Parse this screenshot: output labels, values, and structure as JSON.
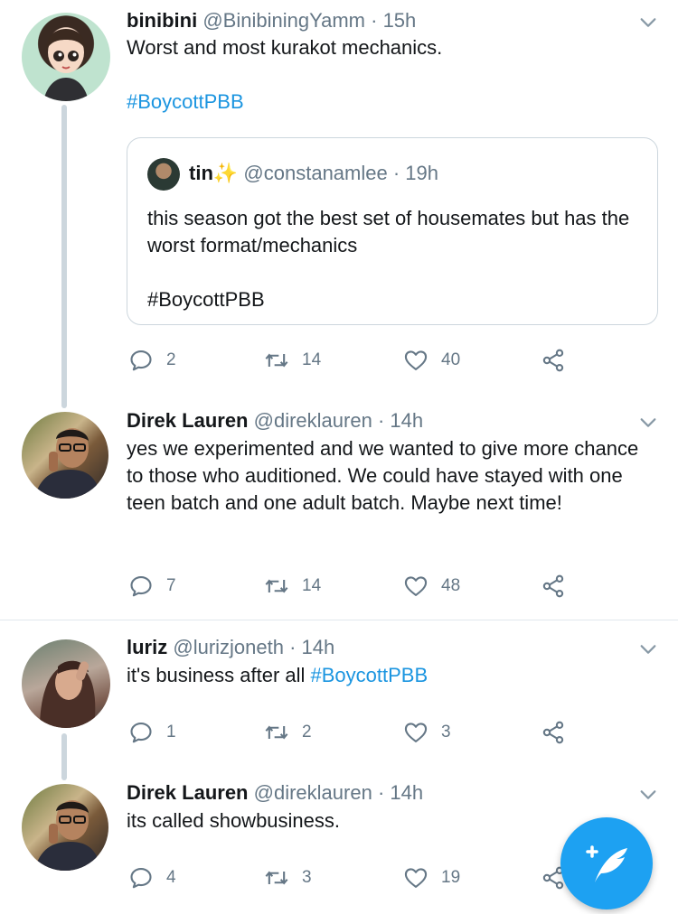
{
  "colors": {
    "accent": "#1da1f2",
    "hashtag": "#1b95e0",
    "muted": "#657786",
    "text": "#14171a"
  },
  "tweets": [
    {
      "author": "binibini",
      "handle": "@BinibiningYamm",
      "time": "· 15h",
      "text": "Worst and most kurakot mechanics.",
      "hashtag": "#BoycottPBB",
      "quote": {
        "author": "tin",
        "emoji": "✨",
        "handle": "@constanamlee",
        "time": "· 19h",
        "text": "this season got the best set of housemates but has the worst format/mechanics",
        "hashtag": "#BoycottPBB"
      },
      "replies": "2",
      "retweets": "14",
      "likes": "40"
    },
    {
      "author": "Direk Lauren",
      "handle": "@direklauren",
      "time": "· 14h",
      "text": "yes we experimented and we wanted to give more chance to those who auditioned. We could have stayed with one teen batch and one adult batch.  Maybe next time!",
      "replies": "7",
      "retweets": "14",
      "likes": "48"
    },
    {
      "author": "luriz",
      "handle": "@lurizjoneth",
      "time": "· 14h",
      "text": "it's business after all ",
      "hashtag": "#BoycottPBB",
      "replies": "1",
      "retweets": "2",
      "likes": "3"
    },
    {
      "author": "Direk Lauren",
      "handle": "@direklauren",
      "time": "· 14h",
      "text": "its called showbusiness.",
      "replies": "4",
      "retweets": "3",
      "likes": "19"
    }
  ],
  "icons": {
    "reply": "reply-icon",
    "retweet": "retweet-icon",
    "like": "heart-icon",
    "share": "share-icon",
    "more": "chevron-down-icon",
    "compose": "compose-tweet-icon"
  }
}
